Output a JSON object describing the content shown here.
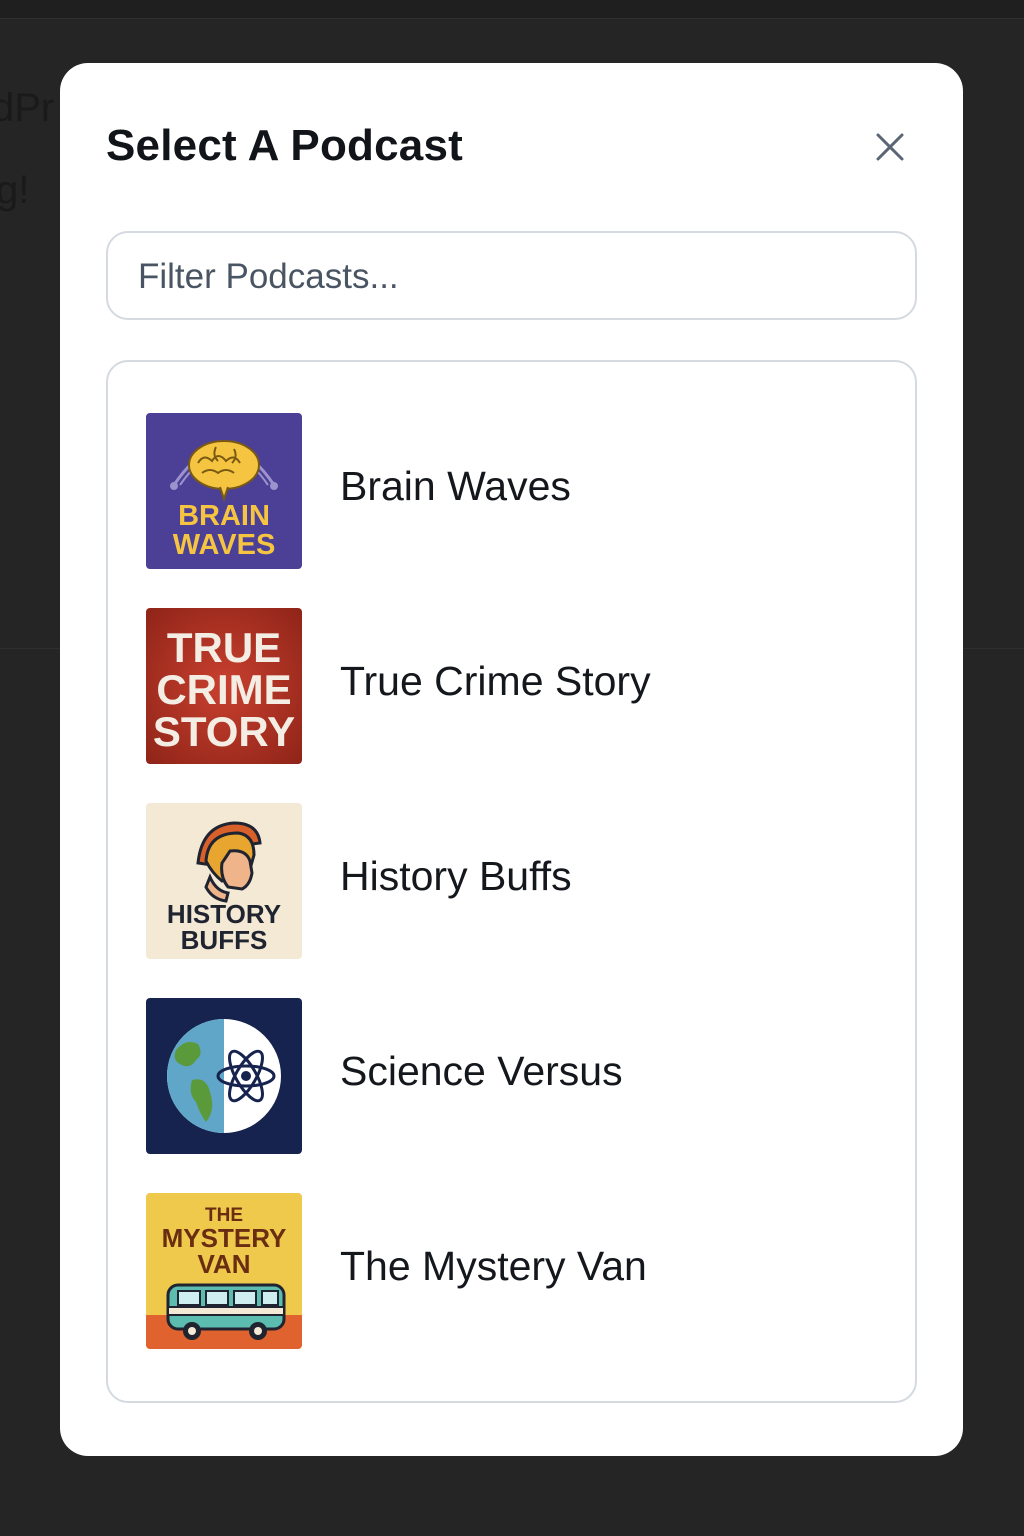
{
  "background": {
    "line1": "dPr",
    "line2": "g!"
  },
  "modal": {
    "title": "Select A Podcast",
    "close_icon": "close-icon",
    "search": {
      "placeholder": "Filter Podcasts...",
      "value": ""
    },
    "podcasts": [
      {
        "name": "Brain Waves",
        "art_text": [
          "BRAIN",
          "WAVES"
        ],
        "art_icon": "brain-icon",
        "colors": {
          "bg": "#4b3f96",
          "text": "#f5c542"
        }
      },
      {
        "name": "True Crime Story",
        "art_text": [
          "TRUE",
          "CRIME",
          "STORY"
        ],
        "colors": {
          "bg": "#b8352b",
          "text": "#f4ede4"
        }
      },
      {
        "name": "History Buffs",
        "art_text": [
          "HISTORY",
          "BUFFS"
        ],
        "art_icon": "spartan-helmet-icon",
        "colors": {
          "bg": "#f3e9d4",
          "text": "#1f2430"
        }
      },
      {
        "name": "Science Versus",
        "art_icon": "earth-atom-icon",
        "colors": {
          "bg": "#16234f"
        }
      },
      {
        "name": "The Mystery Van",
        "art_text": [
          "THE",
          "MYSTERY",
          "VAN"
        ],
        "art_icon": "van-icon",
        "colors": {
          "bg": "#efc94c",
          "text": "#6a2d12"
        }
      }
    ]
  }
}
